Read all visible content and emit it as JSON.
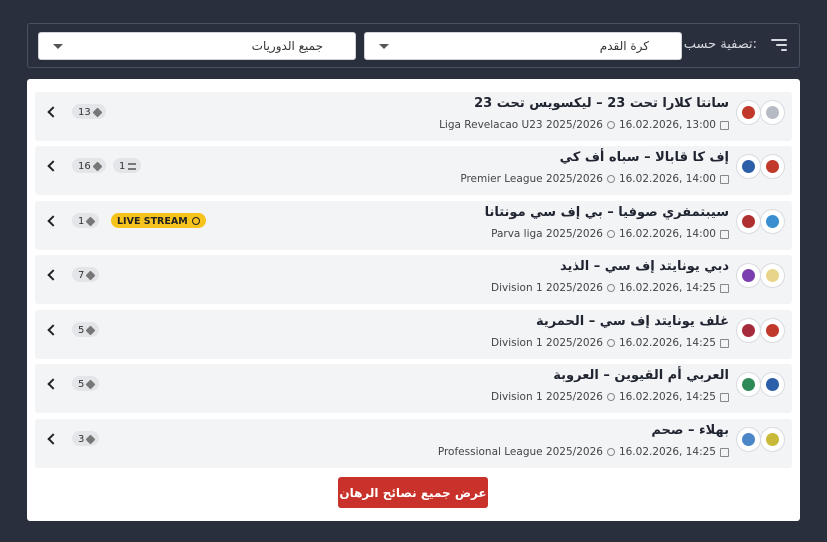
{
  "filter": {
    "label": "تصفية حسب:",
    "sport": "كرة القدم",
    "league": "جميع الدوريات"
  },
  "matches": [
    {
      "title": "سانتا كلارا تحت 23 – ليكسويس تحت 23",
      "date": "16.02.2026, 13:00",
      "league": "Liga Revelacao U23 2025/2026",
      "tips": "13",
      "predictions": "",
      "live": "",
      "home_color": "#b7bcc4",
      "away_color": "#c0392b"
    },
    {
      "title": "إف كا قابالا – سباه أف كي",
      "date": "16.02.2026, 14:00",
      "league": "Premier League 2025/2026",
      "tips": "16",
      "predictions": "1",
      "live": "",
      "home_color": "#c0392b",
      "away_color": "#2d5fa8"
    },
    {
      "title": "سيبتمفري صوفيا – بي إف سي مونتانا",
      "date": "16.02.2026, 14:00",
      "league": "Parva liga 2025/2026",
      "tips": "1",
      "predictions": "",
      "live": "LIVE STREAM",
      "home_color": "#3a8fd1",
      "away_color": "#b03030"
    },
    {
      "title": "دبي يونايتد إف سي – الذيد",
      "date": "16.02.2026, 14:25",
      "league": "Division 1 2025/2026",
      "tips": "7",
      "predictions": "",
      "live": "",
      "home_color": "#e8d58a",
      "away_color": "#7b3fb0"
    },
    {
      "title": "غلف يونايتد إف سي – الحمرية",
      "date": "16.02.2026, 14:25",
      "league": "Division 1 2025/2026",
      "tips": "5",
      "predictions": "",
      "live": "",
      "home_color": "#c0392b",
      "away_color": "#a52a3a"
    },
    {
      "title": "العربي أم القيوين – العروبة",
      "date": "16.02.2026, 14:25",
      "league": "Division 1 2025/2026",
      "tips": "5",
      "predictions": "",
      "live": "",
      "home_color": "#2d5fa8",
      "away_color": "#2e8b57"
    },
    {
      "title": "بهلاء – صحم",
      "date": "16.02.2026, 14:25",
      "league": "Professional League 2025/2026",
      "tips": "3",
      "predictions": "",
      "live": "",
      "home_color": "#c9b93a",
      "away_color": "#4a86c8"
    }
  ],
  "cta_label": "عرض جميع نصائح الرهان",
  "icons": {
    "filter": "filter-lines-icon",
    "chevron": "chevron-left-icon",
    "tip": "tag-icon",
    "prediction": "list-icon",
    "calendar": "calendar-icon",
    "league": "gear-icon"
  }
}
